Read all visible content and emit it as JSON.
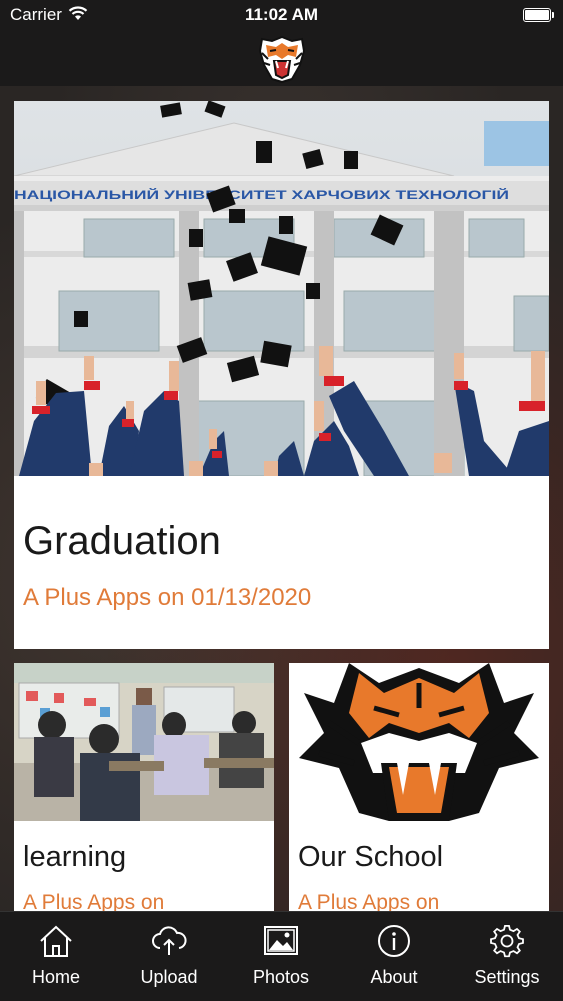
{
  "status_bar": {
    "carrier": "Carrier",
    "time": "11:02 AM"
  },
  "colors": {
    "accent": "#e07b39",
    "bar_bg": "#1b1a1a",
    "card_bg": "#ffffff"
  },
  "feed": {
    "featured": {
      "title": "Graduation",
      "byline": "A Plus Apps on 01/13/2020",
      "sign_text": "НАЦІОНАЛЬНИЙ УНІВЕРСИТЕТ ХАРЧОВИХ ТЕХНОЛОГІЙ"
    },
    "items": [
      {
        "title": "learning",
        "byline": "A Plus Apps on"
      },
      {
        "title": "Our School",
        "byline": "A Plus Apps on"
      }
    ]
  },
  "tabs": [
    {
      "label": "Home",
      "icon": "home-icon"
    },
    {
      "label": "Upload",
      "icon": "cloud-upload-icon"
    },
    {
      "label": "Photos",
      "icon": "photos-icon"
    },
    {
      "label": "About",
      "icon": "info-icon"
    },
    {
      "label": "Settings",
      "icon": "gear-icon"
    }
  ]
}
